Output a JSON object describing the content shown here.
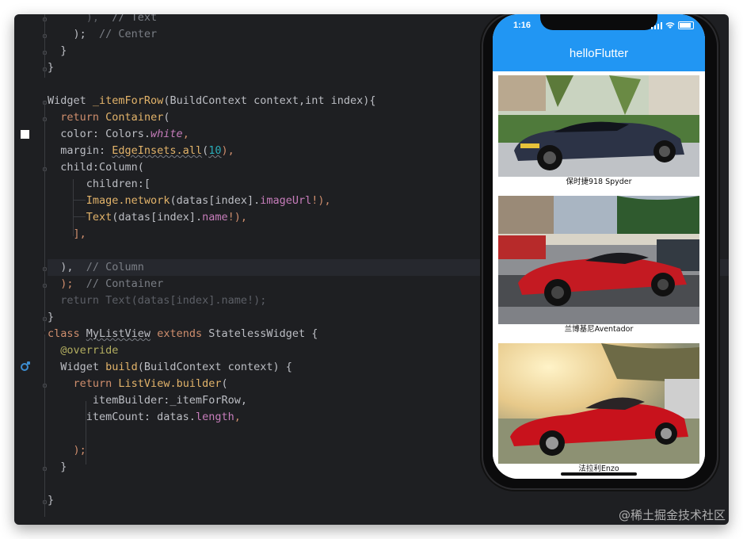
{
  "editor": {
    "lines": [
      {
        "parts": [
          {
            "t": "      ),  ",
            "c": "dim"
          },
          {
            "t": "// Text",
            "c": "cm"
          }
        ]
      },
      {
        "parts": [
          {
            "t": "    );  ",
            "c": ""
          },
          {
            "t": "// Center",
            "c": "cm"
          }
        ]
      },
      {
        "parts": [
          {
            "t": "  }",
            "c": ""
          }
        ]
      },
      {
        "parts": [
          {
            "t": "}",
            "c": ""
          }
        ]
      },
      {
        "parts": [
          {
            "t": "",
            "c": ""
          }
        ]
      },
      {
        "parts": [
          {
            "t": "Widget ",
            "c": ""
          },
          {
            "t": "_itemForRow",
            "c": "fn"
          },
          {
            "t": "(BuildContext context,",
            "c": ""
          },
          {
            "t": "int",
            "c": ""
          },
          {
            "t": " index){",
            "c": ""
          }
        ]
      },
      {
        "parts": [
          {
            "t": "  ",
            "c": ""
          },
          {
            "t": "return ",
            "c": "kw"
          },
          {
            "t": "Container",
            "c": "fn"
          },
          {
            "t": "(",
            "c": ""
          }
        ]
      },
      {
        "parts": [
          {
            "t": "  color: Colors.",
            "c": ""
          },
          {
            "t": "white",
            "c": "field italic"
          },
          {
            "t": ",",
            "c": "kw"
          }
        ]
      },
      {
        "parts": [
          {
            "t": "  margin: ",
            "c": ""
          },
          {
            "t": "EdgeInsets.all",
            "c": "fn wavy"
          },
          {
            "t": "(",
            "c": ""
          },
          {
            "t": "10",
            "c": "num wavy"
          },
          {
            "t": "),",
            "c": "kw"
          }
        ]
      },
      {
        "parts": [
          {
            "t": "  child:Column(",
            "c": ""
          }
        ]
      },
      {
        "parts": [
          {
            "t": "      children:[",
            "c": ""
          }
        ]
      },
      {
        "parts": [
          {
            "t": "      ",
            "c": ""
          },
          {
            "t": "Image.network",
            "c": "fn"
          },
          {
            "t": "(datas[index].",
            "c": ""
          },
          {
            "t": "imageUrl",
            "c": "field"
          },
          {
            "t": "!),",
            "c": "kw"
          }
        ]
      },
      {
        "parts": [
          {
            "t": "      ",
            "c": ""
          },
          {
            "t": "Text",
            "c": "fn"
          },
          {
            "t": "(datas[index].",
            "c": ""
          },
          {
            "t": "name",
            "c": "field"
          },
          {
            "t": "!),",
            "c": "kw"
          }
        ]
      },
      {
        "parts": [
          {
            "t": "    ],",
            "c": "kw"
          }
        ]
      },
      {
        "parts": [
          {
            "t": "",
            "c": ""
          }
        ]
      },
      {
        "parts": [
          {
            "t": "  ),  ",
            "c": ""
          },
          {
            "t": "// Column",
            "c": "cm"
          }
        ]
      },
      {
        "parts": [
          {
            "t": "  );  ",
            "c": "kw"
          },
          {
            "t": "// Container",
            "c": "cm"
          }
        ]
      },
      {
        "parts": [
          {
            "t": "  return Text(datas[index].name!);",
            "c": "dim"
          }
        ]
      },
      {
        "parts": [
          {
            "t": "}",
            "c": ""
          }
        ]
      },
      {
        "parts": [
          {
            "t": "class ",
            "c": "kw"
          },
          {
            "t": "MyListView",
            "c": "wavy"
          },
          {
            "t": " extends ",
            "c": "kw"
          },
          {
            "t": "StatelessWidget {",
            "c": ""
          }
        ]
      },
      {
        "parts": [
          {
            "t": "  ",
            "c": ""
          },
          {
            "t": "@override",
            "c": "ann"
          }
        ]
      },
      {
        "parts": [
          {
            "t": "  Widget ",
            "c": ""
          },
          {
            "t": "build",
            "c": "fn"
          },
          {
            "t": "(BuildContext context) {",
            "c": ""
          }
        ]
      },
      {
        "parts": [
          {
            "t": "    ",
            "c": ""
          },
          {
            "t": "return ",
            "c": "kw"
          },
          {
            "t": "ListView.builder",
            "c": "fn"
          },
          {
            "t": "(",
            "c": ""
          }
        ]
      },
      {
        "parts": [
          {
            "t": "       itemBuilder:_itemForRow,",
            "c": ""
          }
        ]
      },
      {
        "parts": [
          {
            "t": "      itemCount: datas.",
            "c": ""
          },
          {
            "t": "length",
            "c": "field"
          },
          {
            "t": ",",
            "c": "kw"
          }
        ]
      },
      {
        "parts": [
          {
            "t": "",
            "c": ""
          }
        ]
      },
      {
        "parts": [
          {
            "t": "    );",
            "c": "kw"
          }
        ]
      },
      {
        "parts": [
          {
            "t": "  }",
            "c": ""
          }
        ]
      },
      {
        "parts": [
          {
            "t": "",
            "c": ""
          }
        ]
      },
      {
        "parts": [
          {
            "t": "}",
            "c": ""
          }
        ]
      }
    ]
  },
  "phone": {
    "time": "1:16",
    "app_title": "helloFlutter",
    "items": [
      {
        "name": "保时捷918 Spyder",
        "scene": "porsche"
      },
      {
        "name": "兰博基尼Aventador",
        "scene": "lambo"
      },
      {
        "name": "法拉利Enzo",
        "scene": "ferrari"
      }
    ]
  },
  "watermark": "@稀土掘金技术社区",
  "colors": {
    "editor_bg": "#1e1f22",
    "appbar": "#2196f3",
    "keyword": "#cf8e6d",
    "function": "#e2b36a",
    "field": "#c77dbb",
    "comment": "#7a7e85",
    "number": "#2aacb8"
  }
}
